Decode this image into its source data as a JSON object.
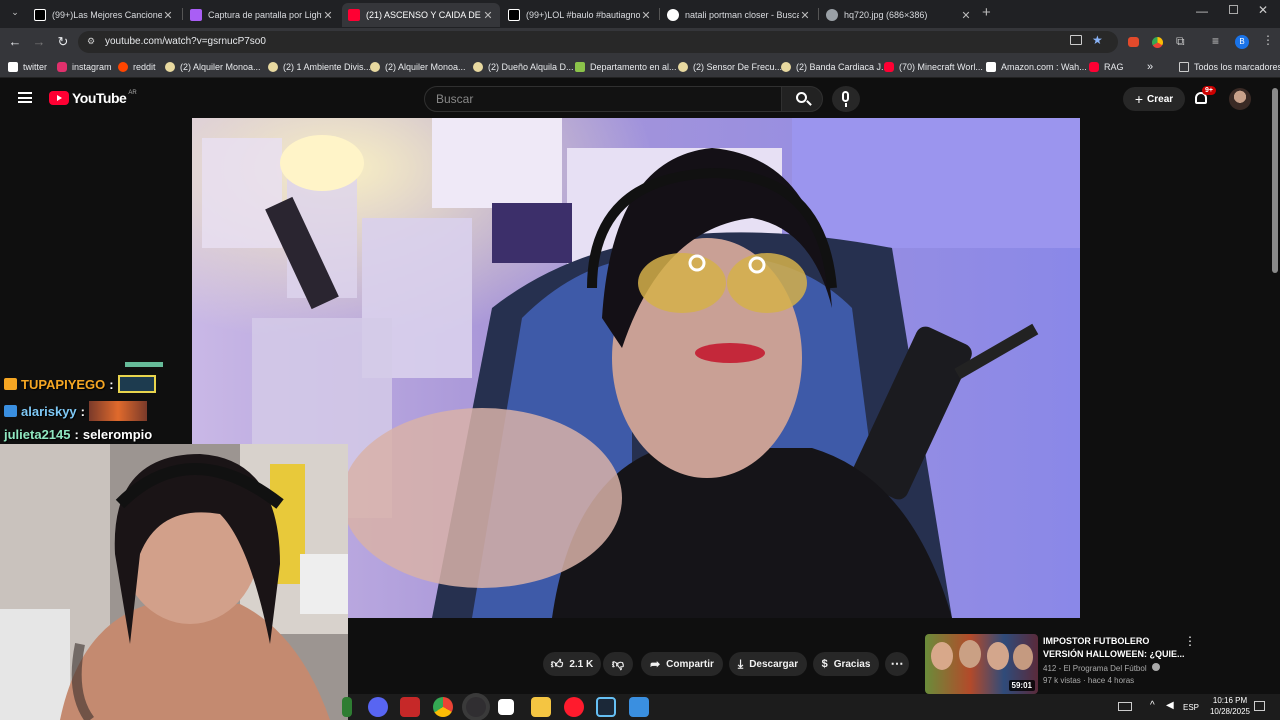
{
  "browser": {
    "tabs": [
      {
        "title": "(99+)Las Mejores Canciones Ra",
        "active": false,
        "favicon_color": "#ffffff"
      },
      {
        "title": "Captura de pantalla por Lightsh",
        "active": false,
        "favicon_color": "#a95ef5"
      },
      {
        "title": "(21) ASCENSO Y CAIDA DE OK",
        "active": true,
        "favicon_color": "#ff0033"
      },
      {
        "title": "(99+)LOL #baulo #bautiagnone",
        "active": false,
        "favicon_color": "#ffffff"
      },
      {
        "title": "natali portman closer - Buscar c",
        "active": false,
        "favicon_color": "#4285f4"
      },
      {
        "title": "hq720.jpg (686×386)",
        "active": false,
        "favicon_color": "#9aa0a6"
      }
    ],
    "new_tab_label": "+",
    "url": "youtube.com/watch?v=gsrnucP7so0",
    "profile_initial": "B",
    "bookmarks": [
      {
        "label": "twitter",
        "icon_color": "#ffffff"
      },
      {
        "label": "instagram",
        "icon_color": "#e1306c"
      },
      {
        "label": "reddit",
        "icon_color": "#ff4500"
      },
      {
        "label": "(2) Alquiler Monoa...",
        "icon_color": "#e8d9a0"
      },
      {
        "label": "(2) 1 Ambiente Divis...",
        "icon_color": "#e8d9a0"
      },
      {
        "label": "(2) Alquiler Monoa...",
        "icon_color": "#e8d9a0"
      },
      {
        "label": "(2) Dueño Alquila D...",
        "icon_color": "#e8d9a0"
      },
      {
        "label": "Departamento en al...",
        "icon_color": "#8bc34a"
      },
      {
        "label": "(2) Sensor De Frecu...",
        "icon_color": "#e8d9a0"
      },
      {
        "label": "(2) Banda Cardiaca J...",
        "icon_color": "#e8d9a0"
      },
      {
        "label": "(70) Minecraft Worl...",
        "icon_color": "#ff0033"
      },
      {
        "label": "Amazon.com : Wah...",
        "icon_color": "#ffffff"
      },
      {
        "label": "RAG",
        "icon_color": "#ff0033"
      }
    ],
    "more_bookmarks": "»",
    "all_bookmarks": "Todos los marcadores"
  },
  "youtube": {
    "logo_text": "YouTube",
    "region": "AR",
    "search_placeholder": "Buscar",
    "create_label": "Crear",
    "notif_badge": "9+",
    "chat": [
      {
        "user": "TUPAPIYEGO",
        "sep": ":",
        "message": "",
        "color": "#f5a623",
        "badge_color": "#f5a623"
      },
      {
        "user": "alariskyy",
        "sep": ":",
        "message": "",
        "color": "#7ec8f5",
        "badge_color": "#3a8fe0"
      },
      {
        "user": "julieta2145",
        "sep": ":",
        "message": "selerompio",
        "color": "#8fe7c0",
        "badge_color": ""
      }
    ],
    "actions": {
      "like_count": "2.1 K",
      "share": "Compartir",
      "download": "Descargar",
      "thanks": "Gracias"
    },
    "related": {
      "title_line1": "IMPOSTOR FUTBOLERO",
      "title_line2": "VERSIÓN HALLOWEEN: ¿QUIE...",
      "channel": "412 - El Programa Del Fútbol",
      "meta": "97 k vistas · hace 4 horas",
      "duration": "59:01"
    }
  },
  "taskbar": {
    "language": "ESP",
    "time": "10:16 PM",
    "date": "10/28/2025"
  }
}
